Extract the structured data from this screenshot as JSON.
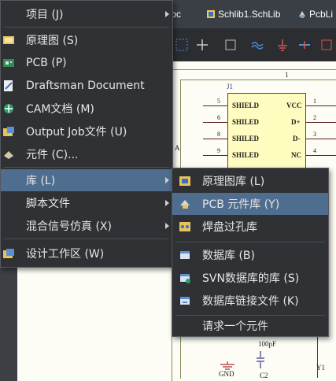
{
  "tabs": [
    {
      "label": "bDoc",
      "icon": "schdoc-icon"
    },
    {
      "label": "Schlib1.SchLib",
      "icon": "schlib-icon"
    },
    {
      "label": "PcbLi",
      "icon": "pcblib-icon"
    }
  ],
  "schematic": {
    "sheet_ref_top": "1",
    "sheet_ref_left": "A",
    "designator": "J1",
    "pins_left": [
      {
        "num": "5",
        "name": "SHIELD"
      },
      {
        "num": "6",
        "name": "SHILED"
      },
      {
        "num": "8",
        "name": "SHILED"
      },
      {
        "num": "9",
        "name": "SHILED"
      }
    ],
    "pins_right": [
      {
        "num": "1",
        "name": "VCC"
      },
      {
        "num": "2",
        "name": "D+"
      },
      {
        "num": "3",
        "name": "D-"
      },
      {
        "num": "4",
        "name": "NC"
      }
    ],
    "cap_value": "100pF",
    "gnd_label": "GND",
    "c2_label": "C2",
    "y1_label": "Y1"
  },
  "main_menu": {
    "items": [
      {
        "label": "项目 (J)",
        "icon": "",
        "submenu": true
      },
      {
        "label": "原理图 (S)",
        "icon": "schematic-icon",
        "submenu": false
      },
      {
        "label": "PCB (P)",
        "icon": "pcb-icon",
        "submenu": false
      },
      {
        "label": "Draftsman Document",
        "icon": "draftsman-icon",
        "submenu": false
      },
      {
        "label": "CAM文档 (M)",
        "icon": "cam-icon",
        "submenu": false
      },
      {
        "label": "Output Job文件 (U)",
        "icon": "output-job-icon",
        "submenu": false
      },
      {
        "label": "元件 (C)...",
        "icon": "component-icon",
        "submenu": false
      },
      {
        "label": "库 (L)",
        "icon": "",
        "submenu": true,
        "active": true
      },
      {
        "label": "脚本文件",
        "icon": "",
        "submenu": true
      },
      {
        "label": "混合信号仿真 (X)",
        "icon": "",
        "submenu": true
      },
      {
        "label": "设计工作区 (W)",
        "icon": "workspace-icon",
        "submenu": false
      }
    ]
  },
  "library_submenu": {
    "items": [
      {
        "label": "原理图库 (L)",
        "icon": "schlib-icon"
      },
      {
        "label": "PCB 元件库 (Y)",
        "icon": "pcblib-icon",
        "active": true
      },
      {
        "label": "焊盘过孔库",
        "icon": "padvia-lib-icon"
      },
      {
        "label": "数据库 (B)",
        "icon": "database-icon"
      },
      {
        "label": "SVN数据库的库 (S)",
        "icon": "svn-dblib-icon"
      },
      {
        "label": "数据库链接文件 (K)",
        "icon": "dblink-icon"
      },
      {
        "label": "请求一个元件",
        "icon": ""
      }
    ]
  },
  "colors": {
    "menu_bg": "#2f3134",
    "menu_highlight": "#4f6d8e",
    "menu_text": "#e6e6e6",
    "part_fill": "#fffcc0"
  }
}
